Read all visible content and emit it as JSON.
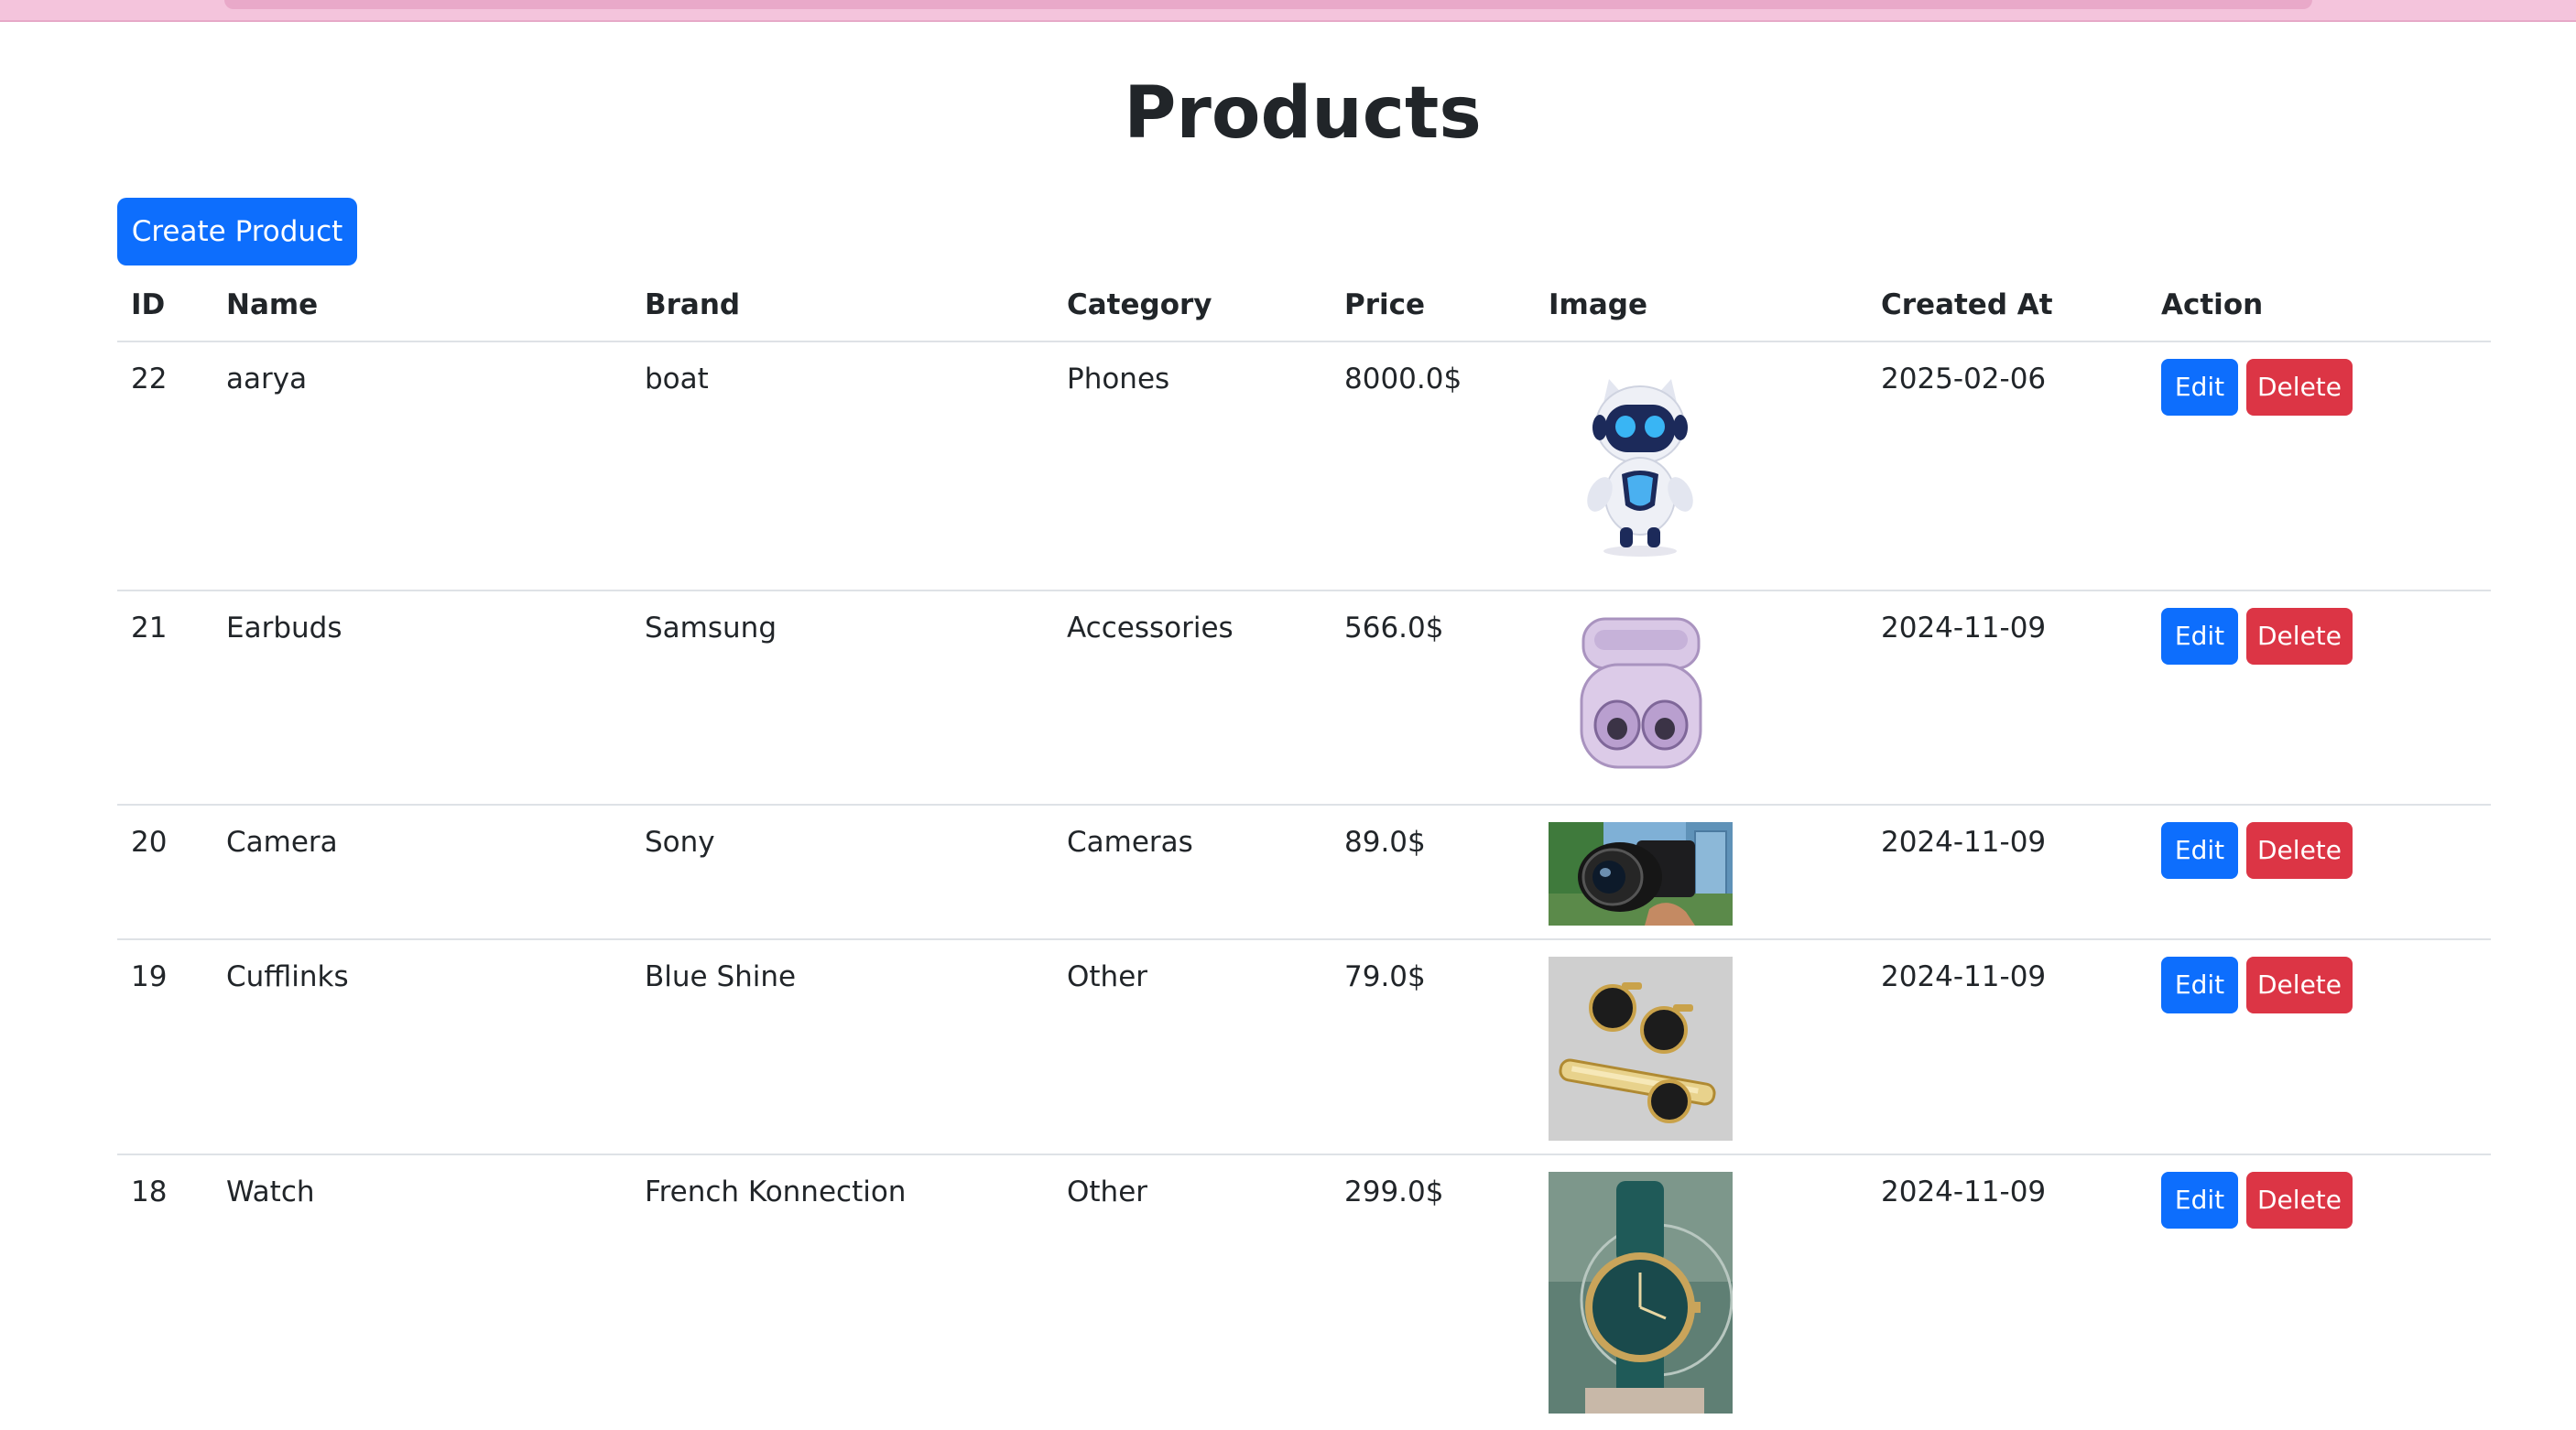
{
  "page": {
    "title": "Products"
  },
  "actions": {
    "create_label": "Create Product"
  },
  "table": {
    "headers": {
      "id": "ID",
      "name": "Name",
      "brand": "Brand",
      "category": "Category",
      "price": "Price",
      "image": "Image",
      "created": "Created At",
      "action": "Action"
    },
    "rows": [
      {
        "id": "22",
        "name": "aarya",
        "brand": "boat",
        "category": "Phones",
        "price": "8000.0$",
        "image": "robot-mascot-image",
        "created": "2025-02-06",
        "edit": "Edit",
        "delete": "Delete"
      },
      {
        "id": "21",
        "name": "Earbuds",
        "brand": "Samsung",
        "category": "Accessories",
        "price": "566.0$",
        "image": "earbuds-case-image",
        "created": "2024-11-09",
        "edit": "Edit",
        "delete": "Delete"
      },
      {
        "id": "20",
        "name": "Camera",
        "brand": "Sony",
        "category": "Cameras",
        "price": "89.0$",
        "image": "camera-lens-image",
        "created": "2024-11-09",
        "edit": "Edit",
        "delete": "Delete"
      },
      {
        "id": "19",
        "name": "Cufflinks",
        "brand": "Blue Shine",
        "category": "Other",
        "price": "79.0$",
        "image": "cufflinks-tieclip-image",
        "created": "2024-11-09",
        "edit": "Edit",
        "delete": "Delete"
      },
      {
        "id": "18",
        "name": "Watch",
        "brand": "French Konnection",
        "category": "Other",
        "price": "299.0$",
        "image": "wristwatch-image",
        "created": "2024-11-09",
        "edit": "Edit",
        "delete": "Delete"
      }
    ]
  },
  "colors": {
    "primary": "#0d6efd",
    "danger": "#dc3545",
    "topbar": "#f4c4dc"
  }
}
